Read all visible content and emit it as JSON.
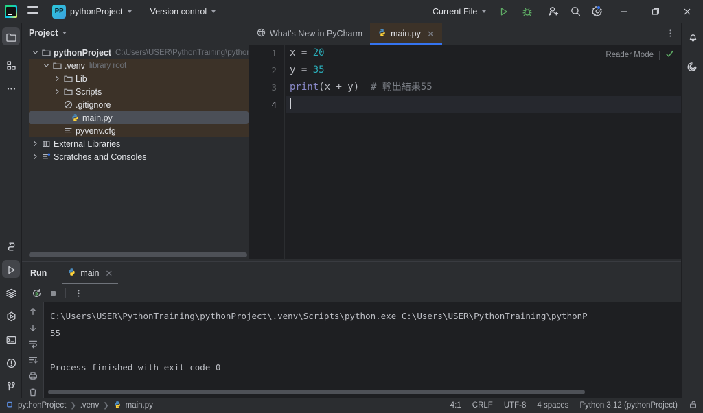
{
  "titlebar": {
    "main_menu_icon": "hamburger-icon",
    "app_logo_icon": "pycharm-logo-icon",
    "project_badge": "PP",
    "project_name": "pythonProject",
    "version_control": "Version control",
    "run_config": "Current File",
    "run_icon": "run-triangle-icon",
    "debug_icon": "debug-bug-icon",
    "more_icon": "more-vertical-icon",
    "account_icon": "add-user-icon",
    "search_icon": "search-icon",
    "settings_icon": "gear-icon",
    "minimize_icon": "minimize-icon",
    "maximize_icon": "maximize-icon",
    "close_icon": "close-icon"
  },
  "left_rail": {
    "top": [
      {
        "name": "project-tool-icon",
        "label": "Project",
        "active": true
      },
      {
        "name": "structure-tool-icon",
        "label": "Structure",
        "active": false
      },
      {
        "name": "more-tool-windows-icon",
        "label": "More tool windows",
        "active": false
      }
    ],
    "bottom": [
      {
        "name": "python-console-icon",
        "label": "Python Console",
        "active": false
      },
      {
        "name": "run-tool-icon",
        "label": "Run",
        "active": true
      },
      {
        "name": "services-icon",
        "label": "Services",
        "active": false
      },
      {
        "name": "profiler-icon",
        "label": "Profiler",
        "active": false
      },
      {
        "name": "terminal-icon",
        "label": "Terminal",
        "active": false
      },
      {
        "name": "problems-icon",
        "label": "Problems",
        "active": false
      },
      {
        "name": "version-control-icon",
        "label": "Version Control",
        "active": false
      }
    ]
  },
  "right_rail": [
    {
      "name": "notifications-bell-icon",
      "label": "Notifications"
    },
    {
      "name": "ai-assistant-icon",
      "label": "AI Assistant"
    }
  ],
  "project_panel": {
    "title": "Project",
    "tree": [
      {
        "label": "pythonProject",
        "sub": "C:\\Users\\USER\\PythonTraining\\pythonProject",
        "icon": "folder-icon",
        "indent": 0,
        "arrow": "down",
        "bold": true,
        "selected": false,
        "excluded": false
      },
      {
        "label": ".venv",
        "sub": "library root",
        "icon": "folder-icon",
        "indent": 1,
        "arrow": "down",
        "bold": false,
        "selected": false,
        "excluded": true
      },
      {
        "label": "Lib",
        "sub": "",
        "icon": "folder-icon",
        "indent": 2,
        "arrow": "right",
        "bold": false,
        "selected": false,
        "excluded": true
      },
      {
        "label": "Scripts",
        "sub": "",
        "icon": "folder-icon",
        "indent": 2,
        "arrow": "right",
        "bold": false,
        "selected": false,
        "excluded": true
      },
      {
        "label": ".gitignore",
        "sub": "",
        "icon": "gitignore-icon",
        "indent": 2,
        "arrow": "none",
        "bold": false,
        "selected": false,
        "excluded": true
      },
      {
        "label": "main.py",
        "sub": "",
        "icon": "python-file-icon",
        "indent": 2,
        "arrow": "none",
        "bold": false,
        "selected": true,
        "excluded": true
      },
      {
        "label": "pyvenv.cfg",
        "sub": "",
        "icon": "config-file-icon",
        "indent": 2,
        "arrow": "none",
        "bold": false,
        "selected": false,
        "excluded": true
      },
      {
        "label": "External Libraries",
        "sub": "",
        "icon": "library-icon",
        "indent": 0,
        "arrow": "right",
        "bold": false,
        "selected": false,
        "excluded": false
      },
      {
        "label": "Scratches and Consoles",
        "sub": "",
        "icon": "scratches-icon",
        "indent": 0,
        "arrow": "right",
        "bold": false,
        "selected": false,
        "excluded": false
      }
    ]
  },
  "editor": {
    "tabs": [
      {
        "label": "What's New in PyCharm",
        "icon": "globe-icon",
        "active": false,
        "closable": false
      },
      {
        "label": "main.py",
        "icon": "python-file-icon",
        "active": true,
        "closable": true
      }
    ],
    "tab_options_icon": "more-vertical-icon",
    "reader_mode_label": "Reader Mode",
    "inspection_icon": "checkmark-ok-icon",
    "lines": [
      {
        "num": "1",
        "current": false,
        "tokens": [
          {
            "t": "x = ",
            "c": "plain"
          },
          {
            "t": "20",
            "c": "num"
          }
        ]
      },
      {
        "num": "2",
        "current": false,
        "tokens": [
          {
            "t": "y = ",
            "c": "plain"
          },
          {
            "t": "35",
            "c": "num"
          }
        ]
      },
      {
        "num": "3",
        "current": false,
        "tokens": [
          {
            "t": "print",
            "c": "fn"
          },
          {
            "t": "(x + y)  ",
            "c": "plain"
          },
          {
            "t": "# 輸出結果55",
            "c": "cmt"
          }
        ]
      },
      {
        "num": "4",
        "current": true,
        "tokens": []
      }
    ]
  },
  "run_panel": {
    "title": "Run",
    "tab_label": "main",
    "tab_icon": "python-file-icon",
    "tab_close_icon": "close-icon",
    "toolbar": [
      {
        "name": "rerun-icon",
        "label": "Rerun"
      },
      {
        "name": "stop-icon",
        "label": "Stop"
      },
      {
        "name": "more-vertical-icon",
        "label": "More"
      }
    ],
    "console_rail": [
      {
        "name": "up-arrow-icon",
        "label": "Previous occurrence"
      },
      {
        "name": "down-arrow-icon",
        "label": "Next occurrence"
      },
      {
        "name": "soft-wrap-icon",
        "label": "Soft-Wrap"
      },
      {
        "name": "scroll-to-end-icon",
        "label": "Scroll to end"
      },
      {
        "name": "print-icon",
        "label": "Print"
      },
      {
        "name": "trash-icon",
        "label": "Clear all"
      }
    ],
    "console_lines": [
      "C:\\Users\\USER\\PythonTraining\\pythonProject\\.venv\\Scripts\\python.exe C:\\Users\\USER\\PythonTraining\\pythonP",
      "55",
      "",
      "Process finished with exit code 0"
    ]
  },
  "statusbar": {
    "breadcrumbs": [
      {
        "label": "pythonProject",
        "icon": "project-square-icon"
      },
      {
        "label": ".venv",
        "icon": "none"
      },
      {
        "label": "main.py",
        "icon": "python-file-icon"
      }
    ],
    "caret_position": "4:1",
    "line_separator": "CRLF",
    "encoding": "UTF-8",
    "indent": "4 spaces",
    "interpreter": "Python 3.12 (pythonProject)",
    "lock_icon": "unlocked-icon"
  },
  "colors": {
    "bg_window": "#1e1f22",
    "bg_panel": "#2b2d30",
    "accent_blue": "#3574f0",
    "excluded_brown": "#3c3228",
    "selection_gray": "#4b4f57",
    "number_teal": "#2aacb8",
    "function_purple": "#8888c6",
    "comment_gray": "#7a7e85",
    "run_green": "#5fad65"
  }
}
